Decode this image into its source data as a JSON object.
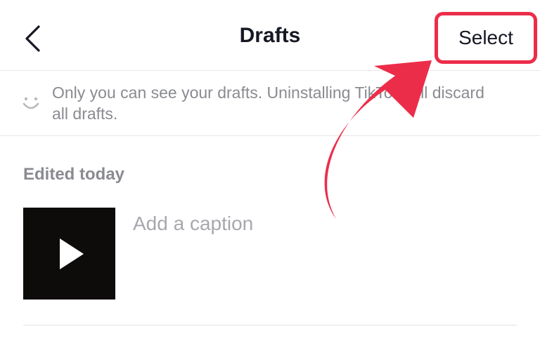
{
  "header": {
    "back_icon": "chevron-left-icon",
    "title": "Drafts",
    "select_label": "Select"
  },
  "notice": {
    "icon": "smile-icon",
    "text_line1": "Only you can see your drafts. Uninstalling TikTok will discard",
    "text_line2": "all drafts."
  },
  "drafts": {
    "section_title": "Edited today",
    "items": [
      {
        "caption_placeholder": "Add a caption",
        "thumbnail_icon": "play-icon"
      }
    ]
  },
  "annotation": {
    "arrow_color": "#ec2d4a",
    "highlight_color": "#ec2d4a"
  }
}
